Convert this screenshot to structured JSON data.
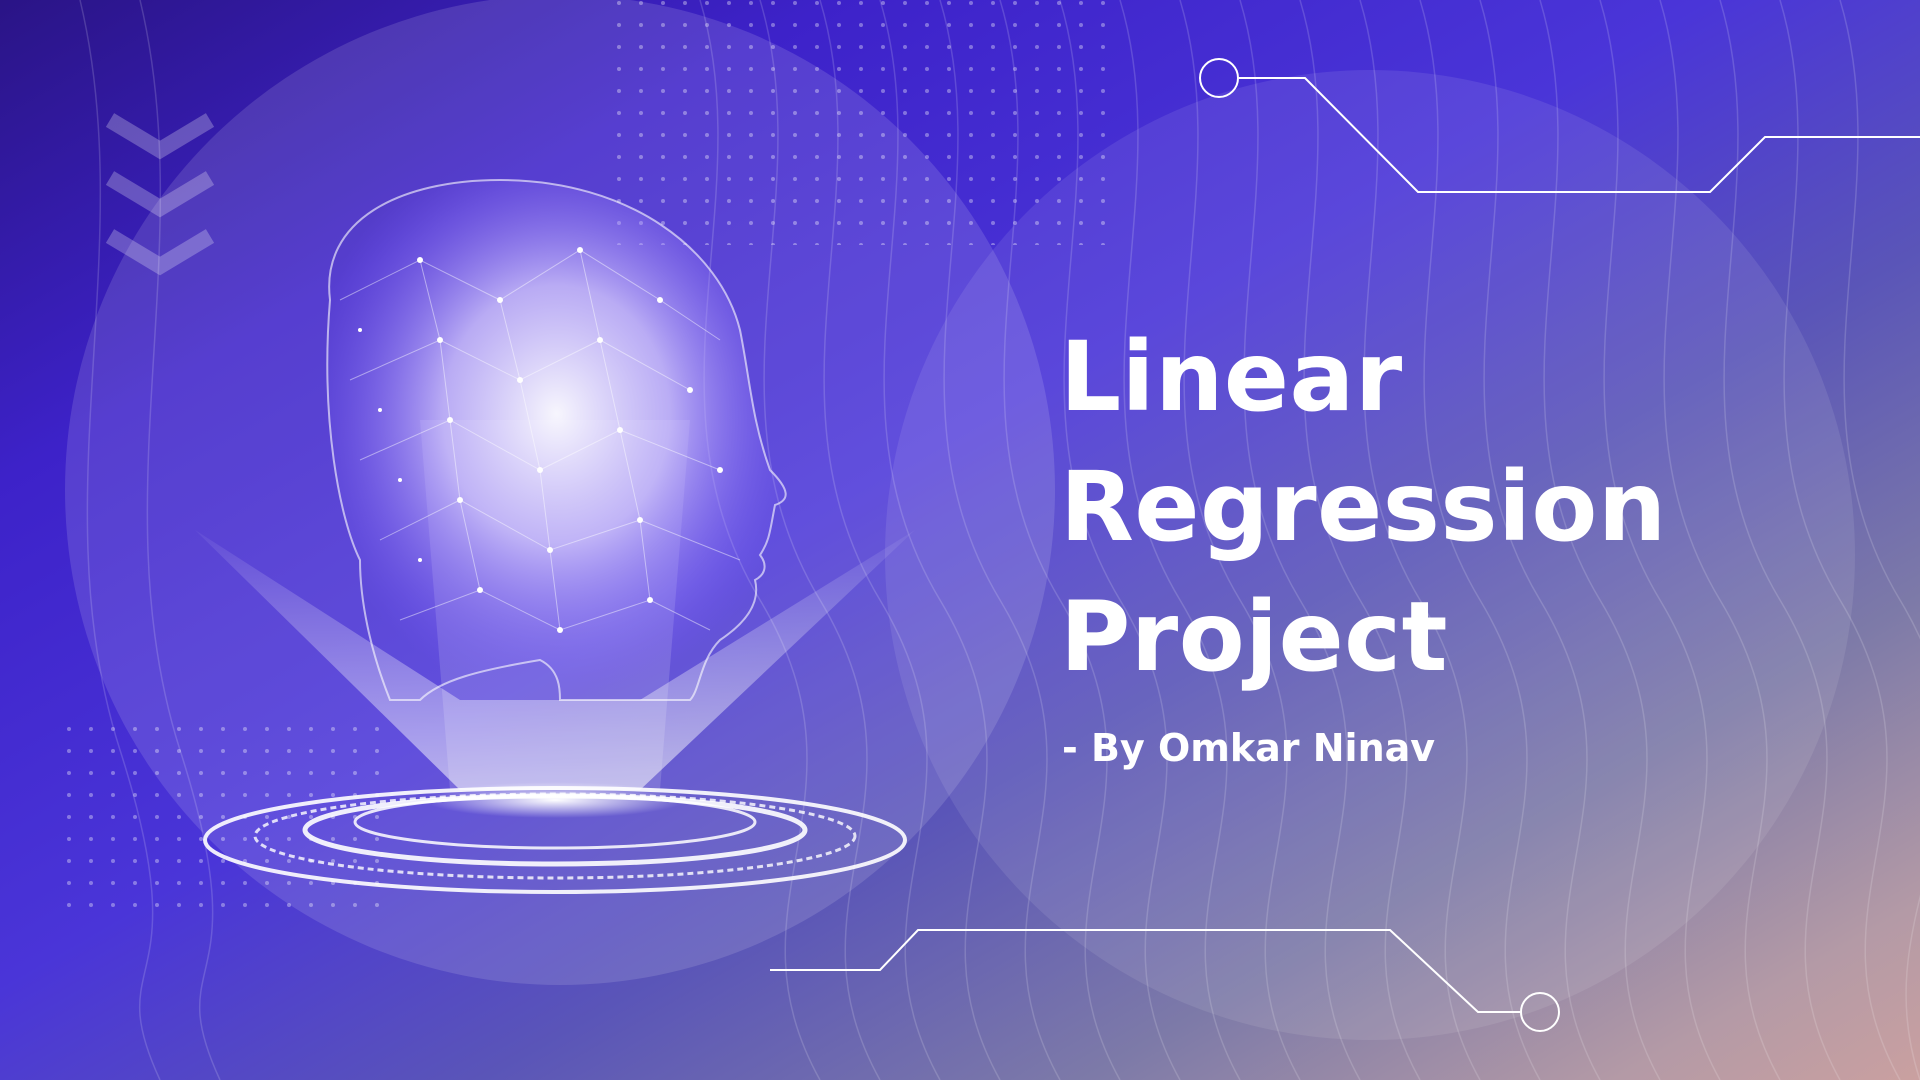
{
  "slide": {
    "title_lines": [
      "Linear",
      "Regression",
      "Project"
    ],
    "author": "- By Omkar Ninav"
  },
  "icons": [
    "chevron-down-icon",
    "ai-head-hologram",
    "hologram-base",
    "circuit-node-icon"
  ],
  "colors": {
    "background_start": "#2a1486",
    "background_mid": "#4a35d8",
    "background_end": "#caa0a0",
    "text": "#ffffff"
  }
}
